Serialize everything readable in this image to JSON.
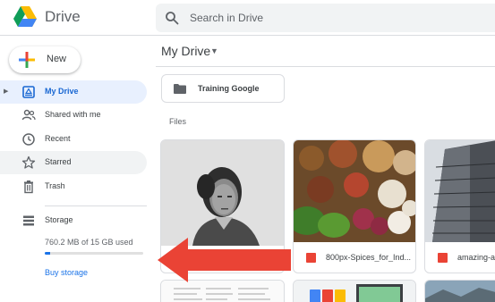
{
  "app": {
    "brand": "Drive",
    "search_placeholder": "Search in Drive"
  },
  "sidebar": {
    "new_label": "New",
    "items": [
      {
        "label": "My Drive",
        "icon": "drive-icon",
        "active": true
      },
      {
        "label": "Shared with me",
        "icon": "people-icon"
      },
      {
        "label": "Recent",
        "icon": "clock-icon"
      },
      {
        "label": "Starred",
        "icon": "star-icon"
      },
      {
        "label": "Trash",
        "icon": "trash-icon"
      }
    ],
    "storage": {
      "label": "Storage",
      "used_text": "760.2 MB of 15 GB used",
      "used_fraction": 0.05,
      "buy_label": "Buy storage"
    }
  },
  "main": {
    "title": "My Drive",
    "folders": [
      {
        "name": "Training Google"
      }
    ],
    "files_label": "Files",
    "files": [
      {
        "name": "",
        "thumb": "portrait-photo"
      },
      {
        "name": "800px-Spices_for_Ind...",
        "thumb": "spices-photo",
        "icon": "image-file-icon"
      },
      {
        "name": "amazing-a",
        "thumb": "building-photo",
        "icon": "image-file-icon"
      }
    ]
  },
  "colors": {
    "accent": "#1a73e8",
    "active_bg": "#e8f0fe",
    "arrow": "#ea4335"
  }
}
